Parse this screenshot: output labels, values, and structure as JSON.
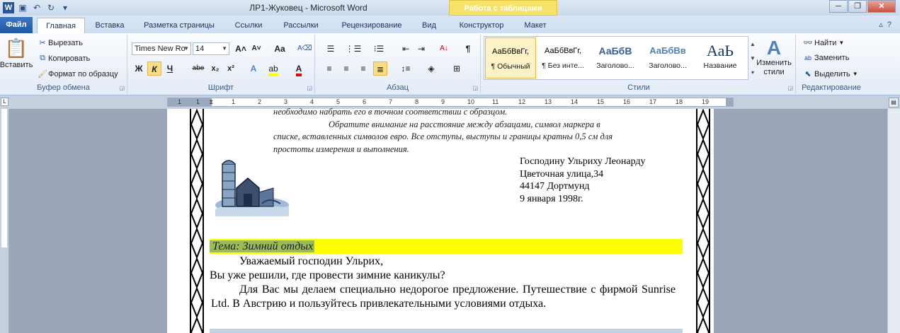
{
  "window": {
    "title": "ЛР1-Жуковец  -  Microsoft Word",
    "context_group": "Работа с таблицами",
    "quick_access": [
      "word-icon",
      "save-icon",
      "undo-icon",
      "redo-icon",
      "customize-icon"
    ]
  },
  "tabs": [
    {
      "label": "Файл"
    },
    {
      "label": "Главная"
    },
    {
      "label": "Вставка"
    },
    {
      "label": "Разметка страницы"
    },
    {
      "label": "Ссылки"
    },
    {
      "label": "Рассылки"
    },
    {
      "label": "Рецензирование"
    },
    {
      "label": "Вид"
    },
    {
      "label": "Конструктор"
    },
    {
      "label": "Макет"
    }
  ],
  "clipboard": {
    "paste": "Вставить",
    "cut": "Вырезать",
    "copy": "Копировать",
    "format_painter": "Формат по образцу",
    "label": "Буфер обмена"
  },
  "font": {
    "name": "Times New Ro",
    "size": "14",
    "label": "Шрифт",
    "bold": "Ж",
    "italic": "К",
    "underline": "Ч",
    "strike": "abe",
    "subscript": "x₂",
    "superscript": "x²",
    "grow": "A˄",
    "shrink": "A˅",
    "case": "Aa"
  },
  "paragraph": {
    "label": "Абзац"
  },
  "styles": {
    "label": "Стили",
    "items": [
      {
        "preview": "АаБбВвГг,",
        "name": "¶ Обычный"
      },
      {
        "preview": "АаБбВвГг,",
        "name": "¶ Без инте..."
      },
      {
        "preview": "АаБбВ",
        "name": "Заголово..."
      },
      {
        "preview": "АаБбВв",
        "name": "Заголово..."
      },
      {
        "preview": "АаЬ",
        "name": "Название"
      }
    ],
    "change": "Изменить стили"
  },
  "editing": {
    "label": "Редактирование",
    "find": "Найти",
    "replace": "Заменить",
    "select": "Выделить"
  },
  "ruler": [
    "1",
    "2",
    "1",
    "1",
    "2",
    "3",
    "4",
    "5",
    "6",
    "7",
    "8",
    "9",
    "10",
    "11",
    "12",
    "13",
    "14",
    "15",
    "16",
    "17",
    "18",
    "19"
  ],
  "document": {
    "instr_lines": [
      "необходимо набрать его в точном соответствии с образцом.",
      "Обратите внимание на расстояние между абзацами, символ маркера в",
      "списке, вставленных символов евро. Все отступы, выступы и границы кратны 0,5 см для",
      "простоты измерения и выполнения."
    ],
    "address": [
      "Господину Ульриху Леонарду",
      "Цветочная улица,34",
      "44147 Дортмунд",
      "9 января 1998г."
    ],
    "subject": "Тема: Зимний отдых",
    "greeting": "Уважаемый господин Ульрих,",
    "question": "Вы уже решили, где провести зимние каникулы?",
    "offer": "Для Вас мы делаем специально недорогое предложение. Путешествие с фирмой Sunrise Ltd. В Австрию и пользуйтесь привлекательными условиями отдыха."
  }
}
